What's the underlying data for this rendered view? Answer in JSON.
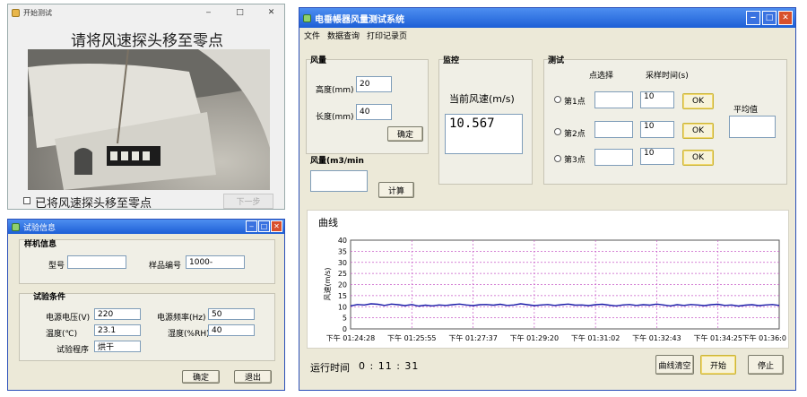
{
  "camera_window": {
    "title": "开始测试",
    "instruction": "请将风速探头移至零点",
    "checkbox_label": "已将风速探头移至零点",
    "next_button": "下一步"
  },
  "info_window": {
    "title": "试验信息",
    "sample_group": "样机信息",
    "model_label": "型号",
    "model_value": "",
    "sample_no_label": "样品编号",
    "sample_no_value": "1000-",
    "condition_group": "试验条件",
    "voltage_label": "电源电压(V)",
    "voltage_value": "220",
    "frequency_label": "电源频率(Hz)",
    "frequency_value": "50",
    "temperature_label": "温度(℃)",
    "temperature_value": "23.1",
    "humidity_label": "湿度(%RH)",
    "humidity_value": "40",
    "program_label": "试验程序",
    "program_value": "烘干",
    "ok_button": "确定",
    "exit_button": "退出"
  },
  "main_window": {
    "title": "电垂帳器风量测试系统",
    "menu": [
      "文件",
      "数据查询",
      "打印记录页"
    ],
    "wind_group": "风量",
    "height_label": "高度(mm)",
    "height_value": "20",
    "length_label": "长度(mm)",
    "length_value": "40",
    "confirm_button": "确定",
    "flow_label": "风量(m3/min",
    "flow_value": "",
    "calc_button": "计算",
    "monitor_group": "监控",
    "current_speed_label": "当前风速(m/s)",
    "current_speed_value": "10.567",
    "test_group": "测试",
    "point_select_label": "点选择",
    "sample_time_label": "采样时间(s)",
    "average_label": "平均值",
    "points": [
      {
        "label": "第1点",
        "value": "",
        "time": "10",
        "ok": "OK"
      },
      {
        "label": "第2点",
        "value": "",
        "time": "10",
        "ok": "OK"
      },
      {
        "label": "第3点",
        "value": "",
        "time": "10",
        "ok": "OK"
      }
    ],
    "curve_label": "曲线",
    "runtime_label": "运行时间",
    "runtime_value": "0 : 11 : 31",
    "clear_button": "曲线清空",
    "start_button": "开始",
    "stop_button": "停止"
  },
  "chart_data": {
    "type": "line",
    "title": "",
    "xlabel": "",
    "ylabel": "风速(m/s)",
    "ylim": [
      0,
      40
    ],
    "yticks": [
      0,
      5,
      10,
      15,
      20,
      25,
      30,
      35,
      40
    ],
    "xticks": [
      "下午 01:24:28",
      "下午 01:25:55",
      "下午 01:27:37",
      "下午 01:29:20",
      "下午 01:31:02",
      "下午 01:32:43",
      "下午 01:34:25",
      "下午 01:36:0"
    ],
    "grid": true,
    "series": [
      {
        "color": "#1a1aa8",
        "values": [
          10.4,
          11.0,
          10.8,
          11.3,
          11.1,
          10.6,
          11.2,
          10.9,
          10.5,
          11.0,
          10.3,
          10.7,
          10.4,
          10.8,
          10.6,
          10.9,
          11.2,
          10.8,
          10.5,
          10.9,
          11.0,
          10.7,
          11.1,
          10.6,
          10.8,
          11.3,
          10.9,
          10.5,
          10.8,
          11.0,
          10.6,
          10.9,
          11.2,
          10.7,
          10.8,
          10.5,
          10.9,
          11.1,
          10.7,
          10.4,
          10.8,
          11.0,
          10.6,
          10.9,
          10.7,
          11.2,
          10.8,
          10.4,
          10.9,
          10.6,
          11.0,
          10.8,
          10.5,
          10.9,
          11.1,
          10.6,
          10.8,
          10.3,
          10.7,
          10.9,
          10.5,
          10.8,
          11.0,
          10.6
        ]
      }
    ]
  }
}
